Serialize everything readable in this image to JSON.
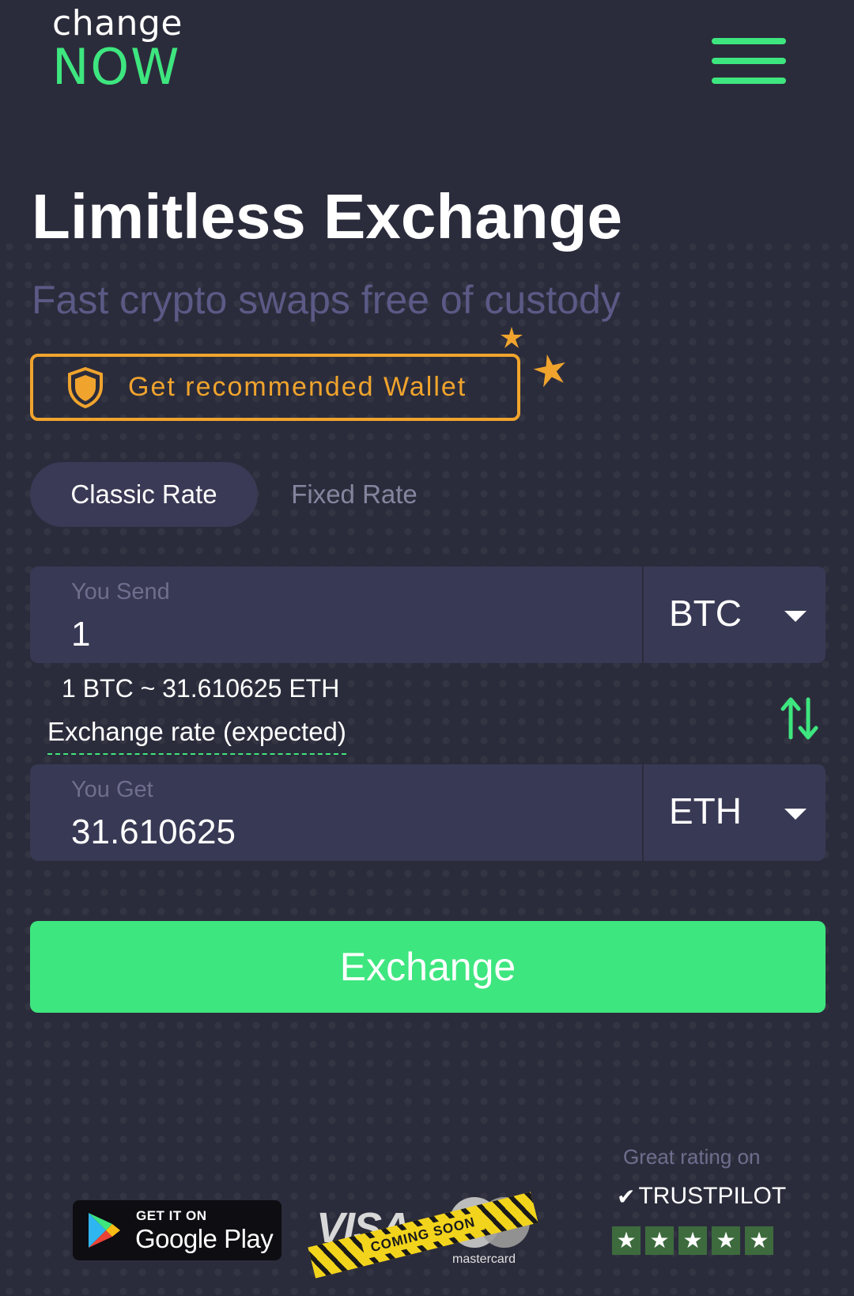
{
  "header": {
    "logo_line1": "change",
    "logo_line2": "NOW",
    "menu_icon": "hamburger-menu-icon"
  },
  "hero": {
    "title": "Limitless Exchange",
    "subtitle": "Fast crypto swaps free of custody"
  },
  "wallet_button": {
    "label": "Get recommended Wallet",
    "icon": "shield-icon"
  },
  "rate_tabs": [
    {
      "label": "Classic Rate",
      "active": true
    },
    {
      "label": "Fixed Rate",
      "active": false
    }
  ],
  "send": {
    "label": "You Send",
    "value": "1",
    "currency": "BTC"
  },
  "rate": {
    "text": "1 BTC ~ 31.610625 ETH",
    "label": "Exchange rate (expected)"
  },
  "get": {
    "label": "You Get",
    "value": "31.610625",
    "currency": "ETH"
  },
  "exchange_button": {
    "label": "Exchange"
  },
  "footer": {
    "google_play_top": "GET IT ON",
    "google_play_main": "Google Play",
    "visa_text": "VISA",
    "mastercard_text": "mastercard",
    "coming_soon": "COMING SOON",
    "rating_caption": "Great rating on",
    "trustpilot": "TRUSTPILOT",
    "stars": 5
  },
  "colors": {
    "background": "#2b2c3b",
    "accent_green": "#3ee67f",
    "wallet_orange": "#f0a42d",
    "field_bg": "#383954",
    "subtitle": "#5b5a86"
  }
}
